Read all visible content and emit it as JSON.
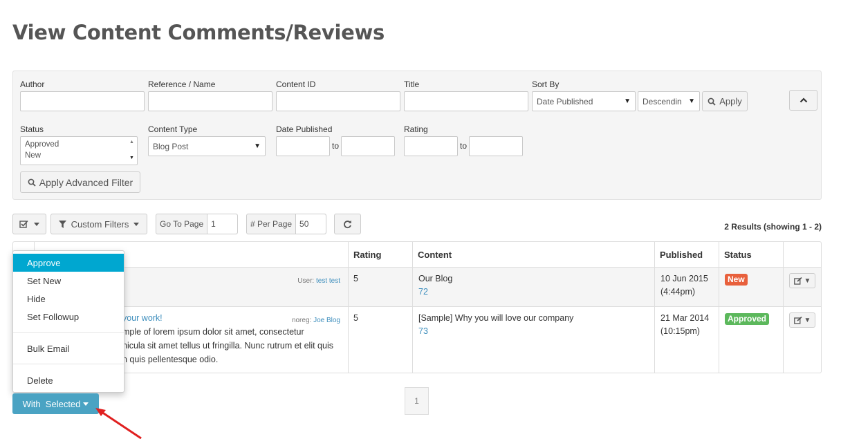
{
  "page": {
    "title": "View Content Comments/Reviews"
  },
  "filters": {
    "author_label": "Author",
    "reference_label": "Reference / Name",
    "content_id_label": "Content ID",
    "title_label": "Title",
    "sort_by_label": "Sort By",
    "sort_by_value": "Date Published",
    "sort_order_value": "Descendin",
    "apply_label": "Apply",
    "status_label": "Status",
    "status_options": [
      "Approved",
      "New"
    ],
    "content_type_label": "Content Type",
    "content_type_value": "Blog Post",
    "date_published_label": "Date Published",
    "rating_label": "Rating",
    "to_label": "to",
    "apply_advanced_label": "Apply Advanced Filter"
  },
  "toolbar": {
    "custom_filters_label": "Custom Filters",
    "go_to_page_label": "Go To Page",
    "go_to_page_value": "1",
    "per_page_label": "# Per Page",
    "per_page_value": "50",
    "results_text": "2 Results (showing 1 - 2)"
  },
  "table": {
    "headers": {
      "rating": "Rating",
      "content": "Content",
      "published": "Published",
      "status": "Status"
    },
    "rows": [
      {
        "user_prefix": "User:",
        "user_name": "test test",
        "rating": "5",
        "content_title": "Our Blog",
        "content_id": "72",
        "published_date": "10 Jun 2015",
        "published_time": "(4:44pm)",
        "status": "New",
        "status_color": "#e8603c"
      },
      {
        "comment_title": "your work!",
        "comment_lines": [
          "mple of lorem ipsum dolor sit amet, consectetur",
          "hicula sit amet tellus ut fringilla. Nunc rutrum et elit quis",
          "n quis pellentesque odio."
        ],
        "user_prefix": "noreg:",
        "user_name": "Joe Blog",
        "rating": "5",
        "content_title": "[Sample] Why you will love our company",
        "content_id": "73",
        "published_date": "21 Mar 2014",
        "published_time": "(10:15pm)",
        "status": "Approved",
        "status_color": "#5cb85c"
      }
    ]
  },
  "bulk_menu": {
    "items": [
      "Approve",
      "Set New",
      "Hide",
      "Set Followup",
      "Bulk Email",
      "Delete"
    ],
    "active_item": "Approve"
  },
  "with_selected_label": "With  Selected",
  "pagination": {
    "current_page": "1"
  },
  "colors": {
    "accent": "#00a7d0",
    "with_selected_bg": "#4aa3c3",
    "link": "#3c8dbc",
    "arrow": "#e02020"
  }
}
